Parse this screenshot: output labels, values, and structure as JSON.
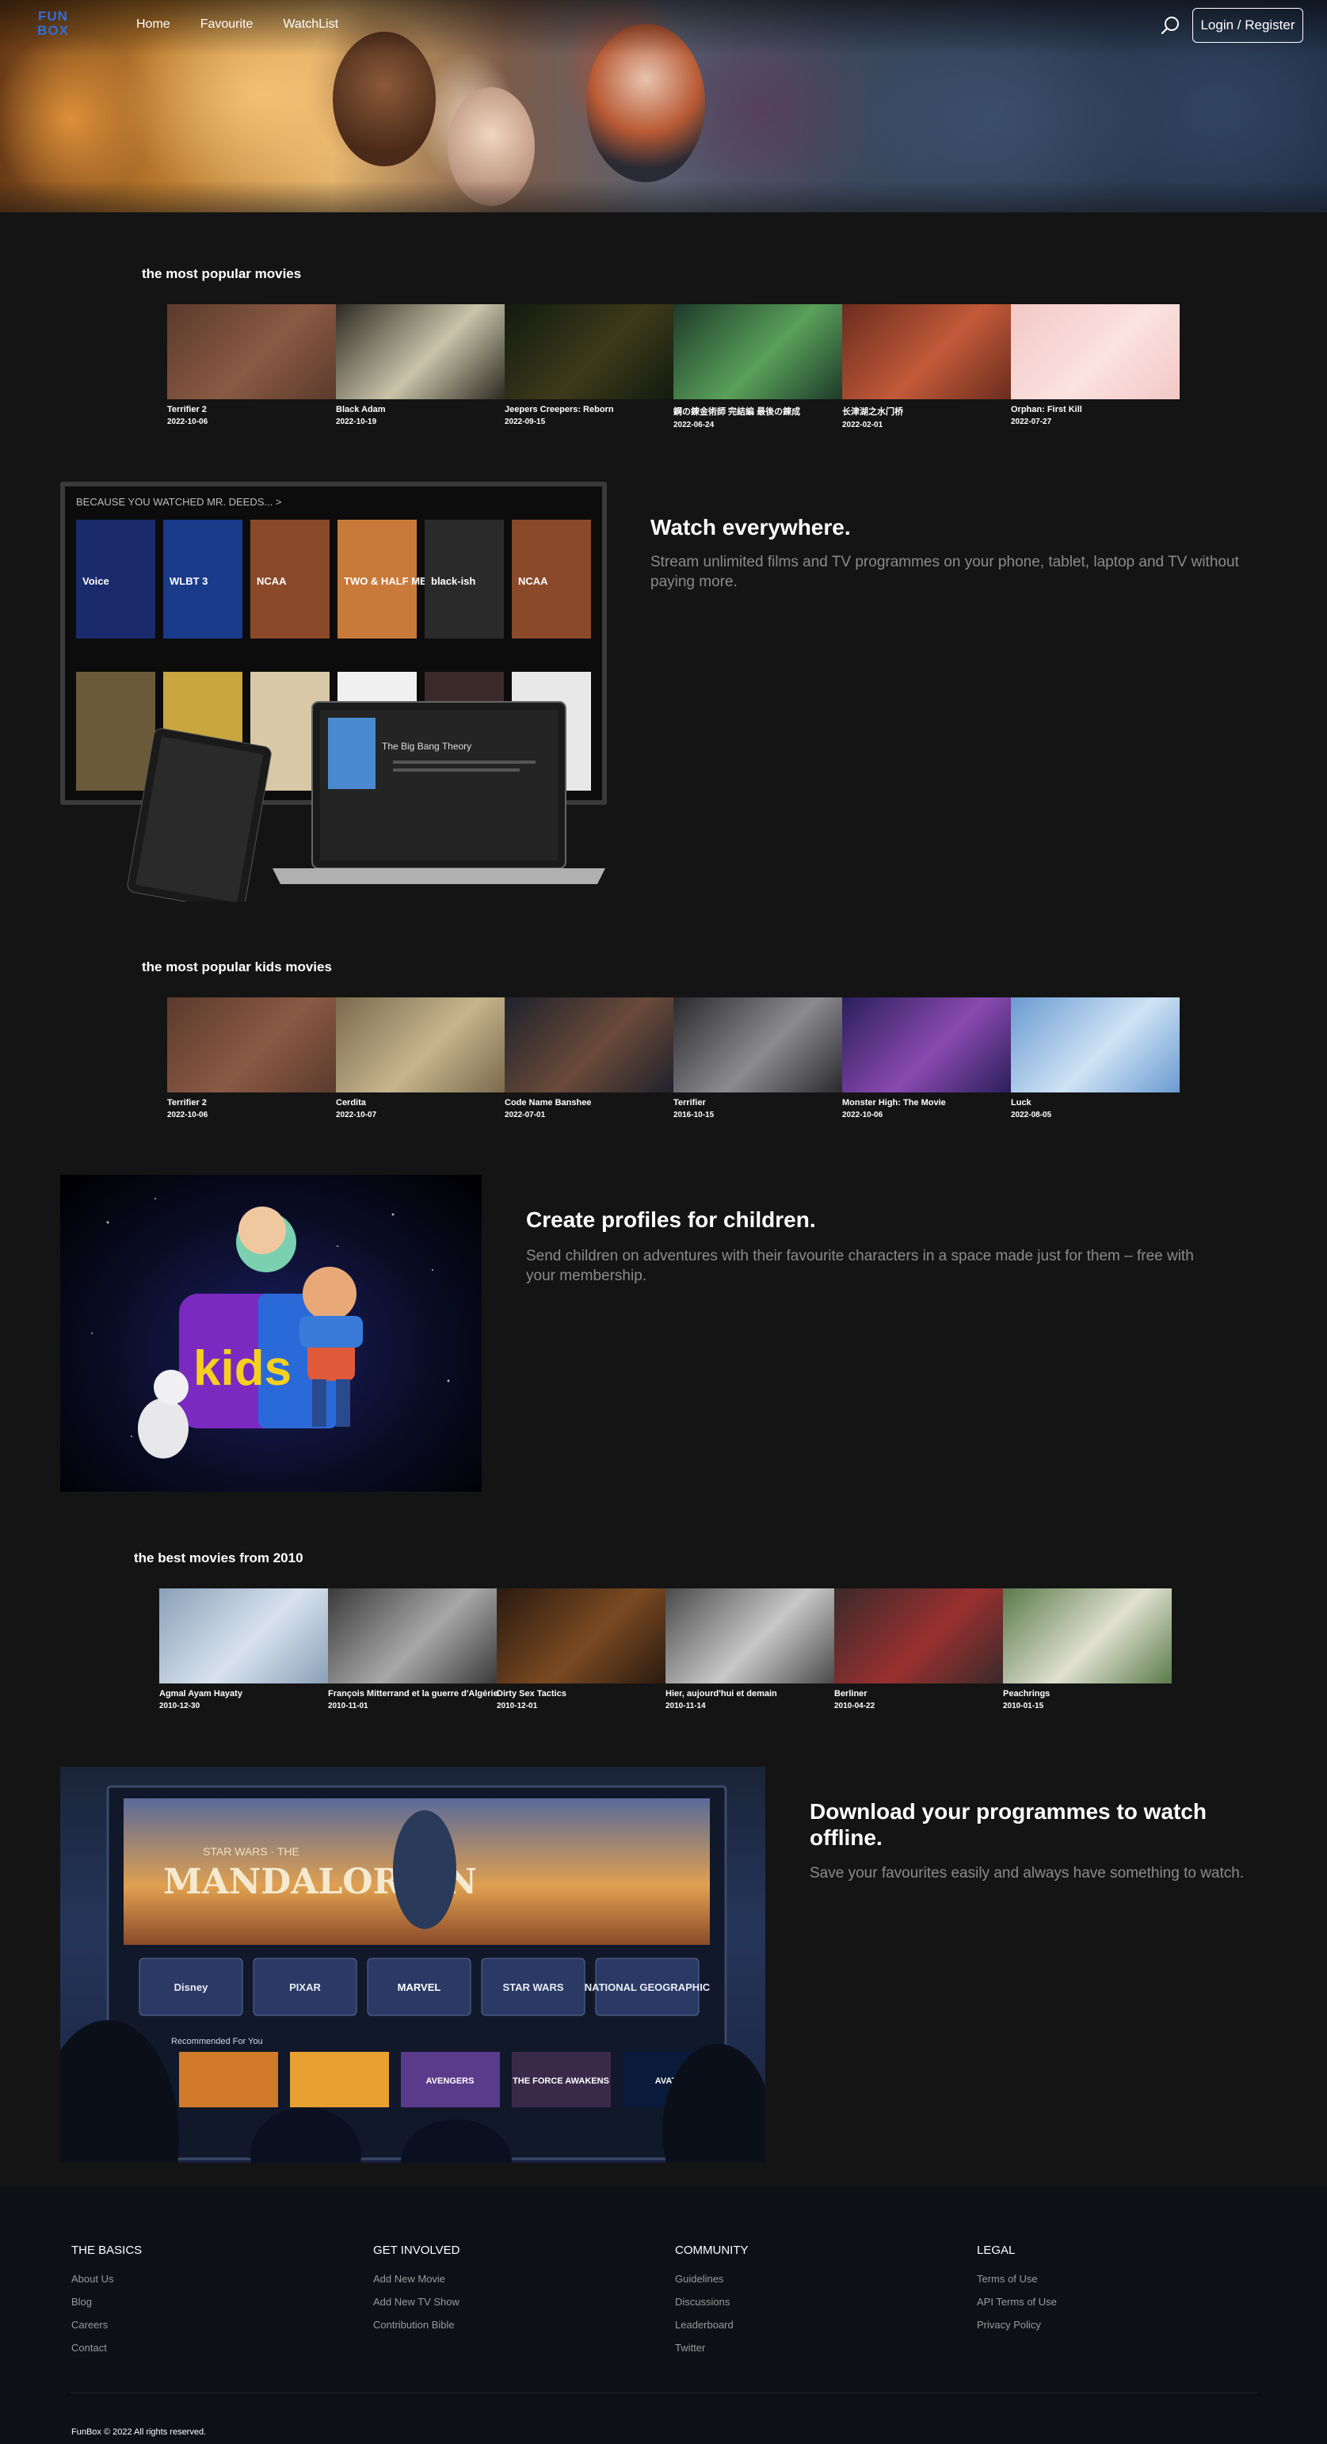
{
  "header": {
    "logo_text": "FUN BOX",
    "nav": [
      "Home",
      "Favourite",
      "WatchList"
    ],
    "login_label": "Login / Register"
  },
  "rows": [
    {
      "title": "the most popular movies",
      "movies": [
        {
          "name": "Terrifier 2",
          "date": "2022-10-06",
          "colors": [
            "#5b3a2c",
            "#8a5a44"
          ]
        },
        {
          "name": "Black Adam",
          "date": "2022-10-19",
          "colors": [
            "#2c2a22",
            "#c9c4a9"
          ]
        },
        {
          "name": "Jeepers Creepers: Reborn",
          "date": "2022-09-15",
          "colors": [
            "#121a10",
            "#3c3a1a"
          ]
        },
        {
          "name": "鋼の錬金術師 完結編 最後の錬成",
          "date": "2022-06-24",
          "colors": [
            "#1d3a2a",
            "#5aa05a"
          ]
        },
        {
          "name": "长津湖之水门桥",
          "date": "2022-02-01",
          "colors": [
            "#6a2c1e",
            "#c25a3a"
          ]
        },
        {
          "name": "Orphan: First Kill",
          "date": "2022-07-27",
          "colors": [
            "#f2c8c6",
            "#fbe2e0"
          ]
        }
      ]
    },
    {
      "title": "the most popular kids movies",
      "movies": [
        {
          "name": "Terrifier 2",
          "date": "2022-10-06",
          "colors": [
            "#5b3a2c",
            "#8a5a44"
          ]
        },
        {
          "name": "Cerdita",
          "date": "2022-10-07",
          "colors": [
            "#7a6a4c",
            "#c7b58e"
          ]
        },
        {
          "name": "Code Name Banshee",
          "date": "2022-07-01",
          "colors": [
            "#1e222c",
            "#6a4a3a"
          ]
        },
        {
          "name": "Terrifier",
          "date": "2016-10-15",
          "colors": [
            "#2a2a2e",
            "#8c8c90"
          ]
        },
        {
          "name": "Monster High: The Movie",
          "date": "2022-10-06",
          "colors": [
            "#2a1f5a",
            "#8a4ab0"
          ]
        },
        {
          "name": "Luck",
          "date": "2022-08-05",
          "colors": [
            "#6a9ad0",
            "#cfe3f5"
          ]
        }
      ]
    },
    {
      "title": "the best movies from 2010",
      "movies": [
        {
          "name": "Agmal Ayam Hayaty",
          "date": "2010-12-30",
          "colors": [
            "#8aa0b8",
            "#d8e2ee"
          ]
        },
        {
          "name": "François Mitterrand et la guerre d'Algérie",
          "date": "2010-11-01",
          "colors": [
            "#3a3a3a",
            "#a8a8a8"
          ]
        },
        {
          "name": "Dirty Sex Tactics",
          "date": "2010-12-01",
          "colors": [
            "#2a1a10",
            "#7a4a22"
          ]
        },
        {
          "name": "Hier, aujourd'hui et demain",
          "date": "2010-11-14",
          "colors": [
            "#4a4a4a",
            "#c8c8c8"
          ]
        },
        {
          "name": "Berliner",
          "date": "2010-04-22",
          "colors": [
            "#3a2a2a",
            "#9a3030"
          ]
        },
        {
          "name": "Peachrings",
          "date": "2010-01-15",
          "colors": [
            "#5a7a4a",
            "#e0e0d0"
          ]
        }
      ]
    }
  ],
  "features": [
    {
      "title": "Watch everywhere.",
      "text": "Stream unlimited films and TV programmes on your phone, tablet, laptop and TV without paying more."
    },
    {
      "title": "Create profiles for children.",
      "text": "Send children on adventures with their favourite characters in a space made just for them – free with your membership."
    },
    {
      "title": "Download your programmes to watch offline.",
      "text": "Save your favourites easily and always have something to watch."
    }
  ],
  "tv_mockup": {
    "banner": "BECAUSE YOU WATCHED MR. DEEDS... >",
    "tiles": [
      "Voice",
      "WLBT 3",
      "NCAA",
      "TWO & HALF MEN",
      "black-ish",
      "NCAA"
    ],
    "laptop_title": "The Big Bang Theory"
  },
  "kids_art": {
    "label": "kids"
  },
  "disney_art": {
    "hero_title": "MANDALORIAN",
    "hero_subtitle": "STAR WARS · THE",
    "brands": [
      "Disney",
      "PIXAR",
      "MARVEL",
      "STAR WARS",
      "NATIONAL GEOGRAPHIC"
    ],
    "row_label": "Recommended For You",
    "row_tiles": [
      "",
      "",
      "AVENGERS",
      "THE FORCE AWAKENS",
      "AVATAR"
    ]
  },
  "footer": {
    "columns": [
      {
        "heading": "THE BASICS",
        "links": [
          "About Us",
          "Blog",
          "Careers",
          "Contact"
        ]
      },
      {
        "heading": "GET INVOLVED",
        "links": [
          "Add New Movie",
          "Add New TV Show",
          "Contribution Bible"
        ]
      },
      {
        "heading": "COMMUNITY",
        "links": [
          "Guidelines",
          "Discussions",
          "Leaderboard",
          "Twitter"
        ]
      },
      {
        "heading": "LEGAL",
        "links": [
          "Terms of Use",
          "API Terms of Use",
          "Privacy Policy"
        ]
      }
    ],
    "copyright": "FunBox © 2022 All rights reserved."
  }
}
